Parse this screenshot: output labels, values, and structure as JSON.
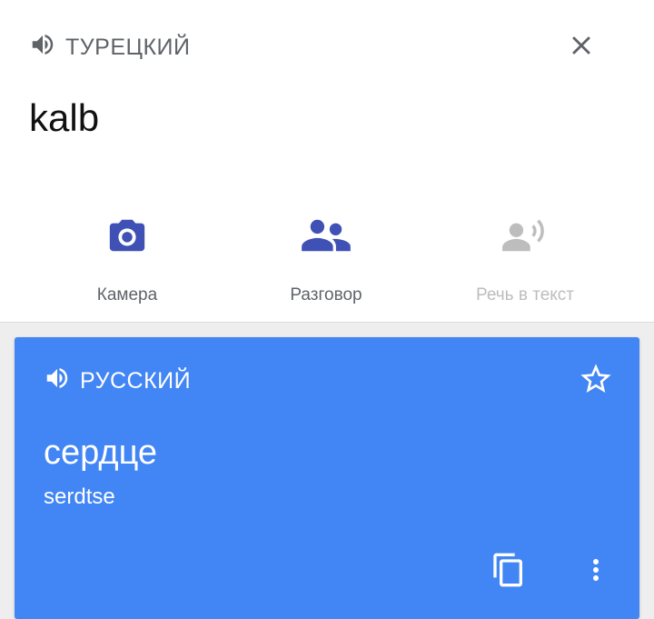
{
  "source": {
    "language": "ТУРЕЦКИЙ",
    "text": "kalb",
    "speaker_icon": "volume-up-icon",
    "close_icon": "close-icon"
  },
  "actions": [
    {
      "label": "Камера",
      "icon": "camera-icon",
      "enabled": true
    },
    {
      "label": "Разговор",
      "icon": "people-icon",
      "enabled": true
    },
    {
      "label": "Речь в текст",
      "icon": "voice-icon",
      "enabled": false
    }
  ],
  "result": {
    "language": "РУССКИЙ",
    "text": "сердце",
    "transliteration": "serdtse",
    "speaker_icon": "volume-up-icon",
    "star_icon": "star-outline-icon",
    "copy_icon": "copy-icon",
    "more_icon": "more-vert-icon"
  },
  "colors": {
    "accent": "#3f51b5",
    "card": "#4285f4",
    "text_secondary": "#5f6368",
    "disabled": "#bdbdbd"
  }
}
